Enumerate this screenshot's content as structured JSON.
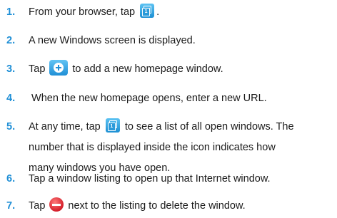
{
  "steps": [
    {
      "num": "1.",
      "before": "From your browser, tap",
      "after": "."
    },
    {
      "num": "2.",
      "text": "A new Windows screen is displayed."
    },
    {
      "num": "3.",
      "before": "Tap",
      "after": "to add a new homepage window."
    },
    {
      "num": "4.",
      "text": " When the new homepage opens, enter a new URL."
    },
    {
      "num": "5.",
      "before": "At any time, tap",
      "after": "to see a list of all open windows. The",
      "line2": "number that is displayed inside the icon indicates how",
      "line3": "many windows you have open."
    },
    {
      "num": "6.",
      "text": "Tap a window listing to open up that Internet window."
    },
    {
      "num": "7.",
      "before": "Tap",
      "after": "next to the listing to delete the window."
    }
  ],
  "icons": {
    "windows_icon_count": "1",
    "windows_icon": "windows-icon",
    "add_icon": "add-window-icon",
    "delete_icon": "delete-icon"
  },
  "colors": {
    "accent": "#1f8fd6",
    "delete": "#d41e2a"
  }
}
